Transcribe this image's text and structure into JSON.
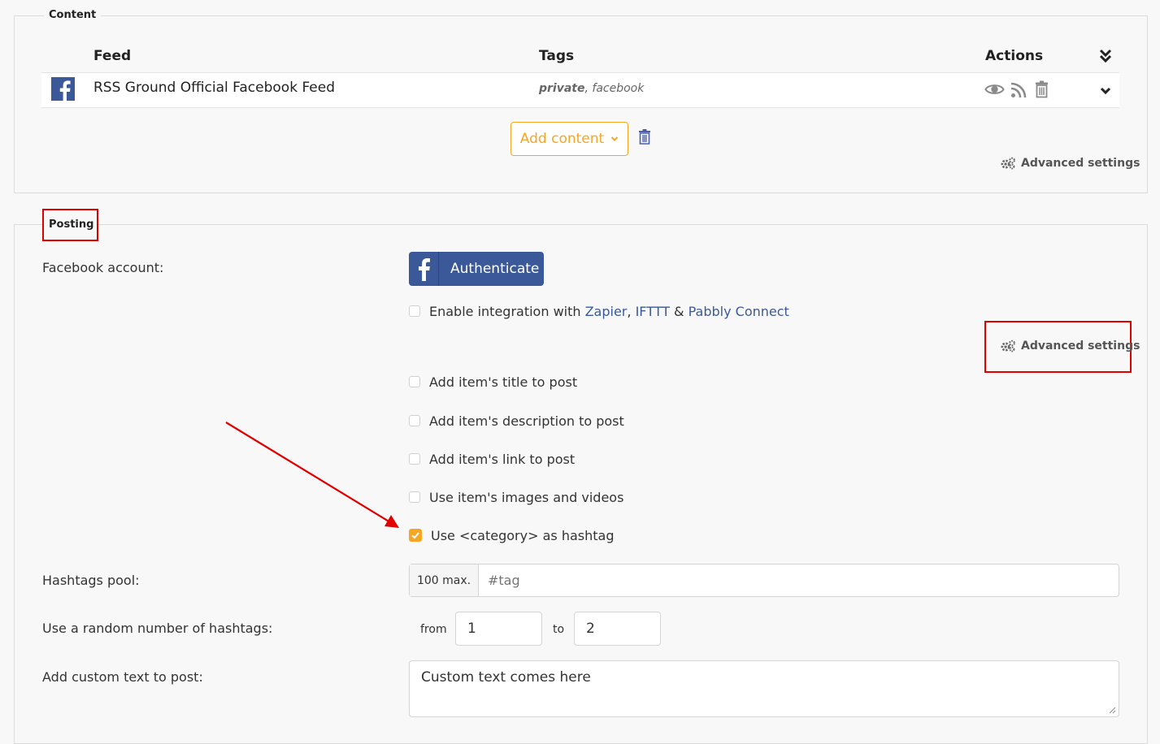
{
  "content_section": {
    "legend": "Content",
    "columns": {
      "feed": "Feed",
      "tags": "Tags",
      "actions": "Actions"
    },
    "feed_row": {
      "name": "RSS Ground Official Facebook Feed",
      "tag_private": "private",
      "tag_separator": ", ",
      "tag_other": "facebook"
    },
    "add_content_label": "Add content",
    "advanced_settings_label": "Advanced settings"
  },
  "posting_section": {
    "legend": "Posting",
    "facebook_account_label": "Facebook account:",
    "authenticate_label": "Authenticate",
    "integration": {
      "prefix": "Enable integration with ",
      "zapier": "Zapier",
      "comma": ", ",
      "ifttt": "IFTTT",
      "amp": " & ",
      "pabbly": "Pabbly Connect"
    },
    "advanced_settings_label": "Advanced settings",
    "options": [
      {
        "label": "Add item's title to post",
        "checked": false
      },
      {
        "label": "Add item's description to post",
        "checked": false
      },
      {
        "label": "Add item's link to post",
        "checked": false
      },
      {
        "label": "Use item's images and videos",
        "checked": false
      },
      {
        "label": "Use <category> as hashtag",
        "checked": true
      }
    ],
    "hashtags_pool_label": "Hashtags pool:",
    "hashtags_max": "100 max.",
    "hashtags_placeholder": "#tag",
    "random_hashtags_label": "Use a random number of hashtags:",
    "from_label": "from",
    "from_value": "1",
    "to_label": "to",
    "to_value": "2",
    "custom_text_label": "Add custom text to post:",
    "custom_text_value": "Custom text comes here"
  },
  "colors": {
    "accent": "#f5a623",
    "facebook": "#3b5998",
    "annotation": "#e00000"
  }
}
